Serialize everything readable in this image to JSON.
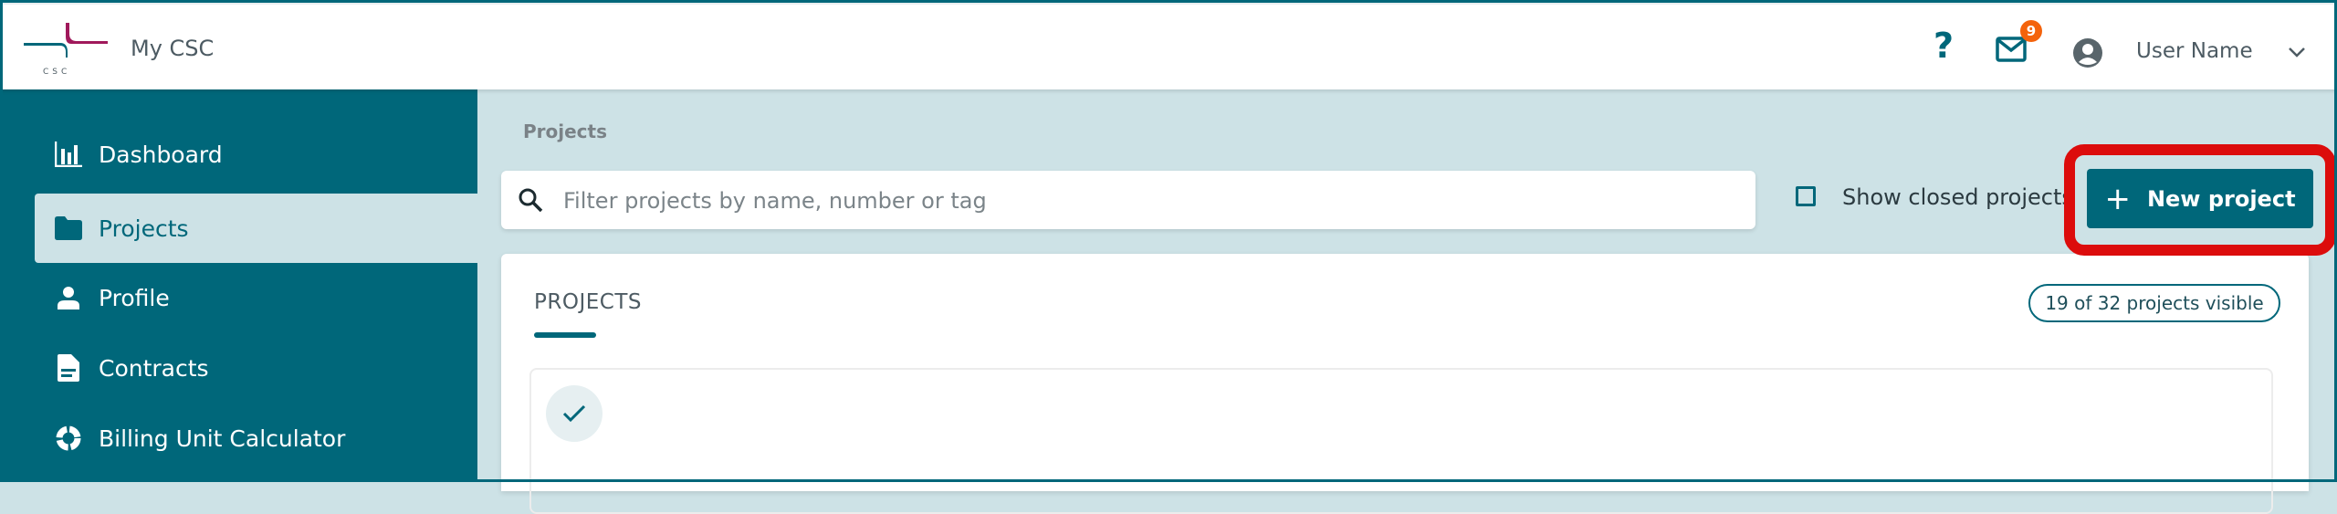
{
  "header": {
    "logo_text": "CSC",
    "app_title": "My CSC",
    "help_label": "?",
    "notifications_count": "9",
    "user_name": "User Name"
  },
  "sidebar": {
    "items": [
      {
        "label": "Dashboard",
        "icon": "bar-chart-icon",
        "active": false
      },
      {
        "label": "Projects",
        "icon": "folder-icon",
        "active": true
      },
      {
        "label": "Profile",
        "icon": "person-icon",
        "active": false
      },
      {
        "label": "Contracts",
        "icon": "document-icon",
        "active": false
      },
      {
        "label": "Billing Unit Calculator",
        "icon": "donut-chart-icon",
        "active": false
      }
    ]
  },
  "main": {
    "breadcrumb": "Projects",
    "search": {
      "placeholder": "Filter projects by name, number or tag",
      "value": ""
    },
    "show_closed": {
      "label": "Show closed projects",
      "checked": false
    },
    "new_project_label": "New project",
    "card": {
      "title": "PROJECTS",
      "visible_count": "19 of 32 projects visible"
    }
  },
  "colors": {
    "brand": "#00677a",
    "accent_magenta": "#a0195b",
    "badge": "#f4630c",
    "highlight": "#dc0c0c",
    "background": "#cde2e6"
  }
}
